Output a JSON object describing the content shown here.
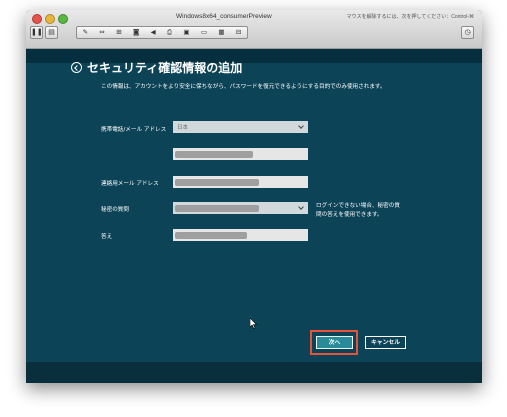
{
  "window": {
    "title": "Windows8x64_consumerPreview",
    "message": "マウスを解除するには、次を押してください：Control-⌘",
    "toolbar_icons": [
      "pause-icon",
      "sidebar-icon",
      "wrench-icon",
      "usb-icon",
      "network-icon",
      "camera-icon",
      "sound-icon",
      "printer-icon",
      "disk-icon",
      "folder-icon",
      "screen-icon",
      "fullscreen-icon"
    ]
  },
  "page": {
    "title": "セキュリティ確認情報の追加",
    "description": "この情報は、アカウントをより安全に保ちながら、パスワードを復元できるようにする目的でのみ使用されます。"
  },
  "form": {
    "phone_label": "携帯電話/メール アドレス",
    "country_value": "日本",
    "alt_email_label": "連絡用メール アドレス",
    "question_label": "秘密の質問",
    "answer_label": "答え",
    "hint": "ログインできない場合、秘密の質問の答えを使用できます。"
  },
  "buttons": {
    "next": "次へ",
    "cancel": "キャンセル"
  },
  "colors": {
    "background": "#0d4357",
    "accent_button": "#2a8b98",
    "highlight_border": "#e5533a"
  }
}
